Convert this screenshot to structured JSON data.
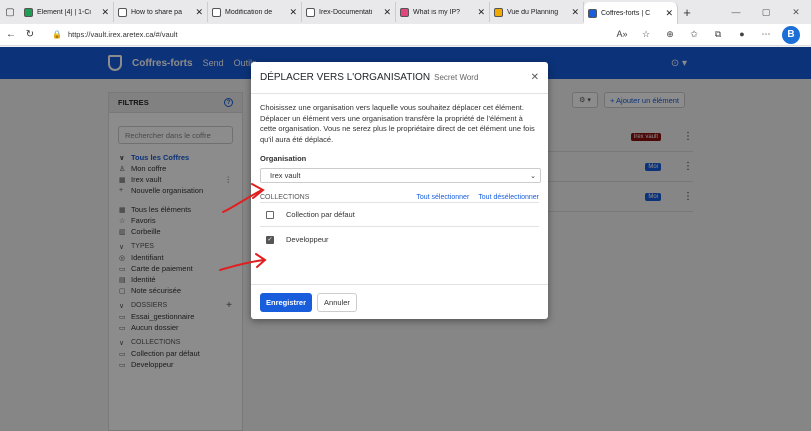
{
  "browser": {
    "tabs": [
      {
        "title": "Element [4] | 1-Ci",
        "fav": "#1f9d55"
      },
      {
        "title": "How to share pa",
        "fav": "#ffffff"
      },
      {
        "title": "Modification de",
        "fav": "#ffffff"
      },
      {
        "title": "Irex-Documentati",
        "fav": "#ffffff"
      },
      {
        "title": "What is my IP?",
        "fav": "#e0467c"
      },
      {
        "title": "Vue du Planning",
        "fav": "#f2a900"
      },
      {
        "title": "Coffres-forts | C",
        "fav": "#175ddc"
      }
    ],
    "url": "https://vault.irex.aretex.ca/#/vault",
    "profile_icon": "B"
  },
  "appnav": {
    "title": "Coffres-forts",
    "links": [
      "Send",
      "Outils"
    ]
  },
  "filters": {
    "heading": "FILTRES",
    "help": "?",
    "search_placeholder": "Rechercher dans le coffre",
    "vaults": [
      "Tous les Coffres",
      "Mon coffre",
      "Irex vault",
      "Nouvelle organisation"
    ],
    "items": [
      "Tous les éléments",
      "Favoris",
      "Corbeille"
    ],
    "types_heading": "TYPES",
    "types": [
      "Identifiant",
      "Carte de paiement",
      "Identité",
      "Note sécurisée"
    ],
    "folders_heading": "DOSSIERS",
    "folders": [
      "Essai_gestionnaire",
      "Aucun dossier"
    ],
    "collections_heading": "COLLECTIONS",
    "collections": [
      "Collection par défaut",
      "Developpeur"
    ]
  },
  "toolbar": {
    "add_label": "+ Ajouter un élément"
  },
  "badges": [
    {
      "label": "Irex vault",
      "color": "#8b0d0d"
    },
    {
      "label": "Moi",
      "color": "#175ddc"
    },
    {
      "label": "Moi",
      "color": "#175ddc"
    }
  ],
  "modal": {
    "title": "Déplacer vers l'organisation",
    "subtitle": "Secret Word",
    "description": "Choisissez une organisation vers laquelle vous souhaitez déplacer cet élément. Déplacer un élément vers une organisation transfère la propriété de l'élément à cette organisation. Vous ne serez plus le propriétaire direct de cet élément une fois qu'il aura été déplacé.",
    "org_label": "Organisation",
    "org_value": "Irex vault",
    "collections_label": "COLLECTIONS",
    "select_all": "Tout sélectionner",
    "deselect_all": "Tout désélectionner",
    "collections": [
      {
        "name": "Collection par défaut",
        "checked": false
      },
      {
        "name": "Developpeur",
        "checked": true
      }
    ],
    "save_label": "Enregistrer",
    "cancel_label": "Annuler"
  },
  "annotation_color": "#e02020"
}
